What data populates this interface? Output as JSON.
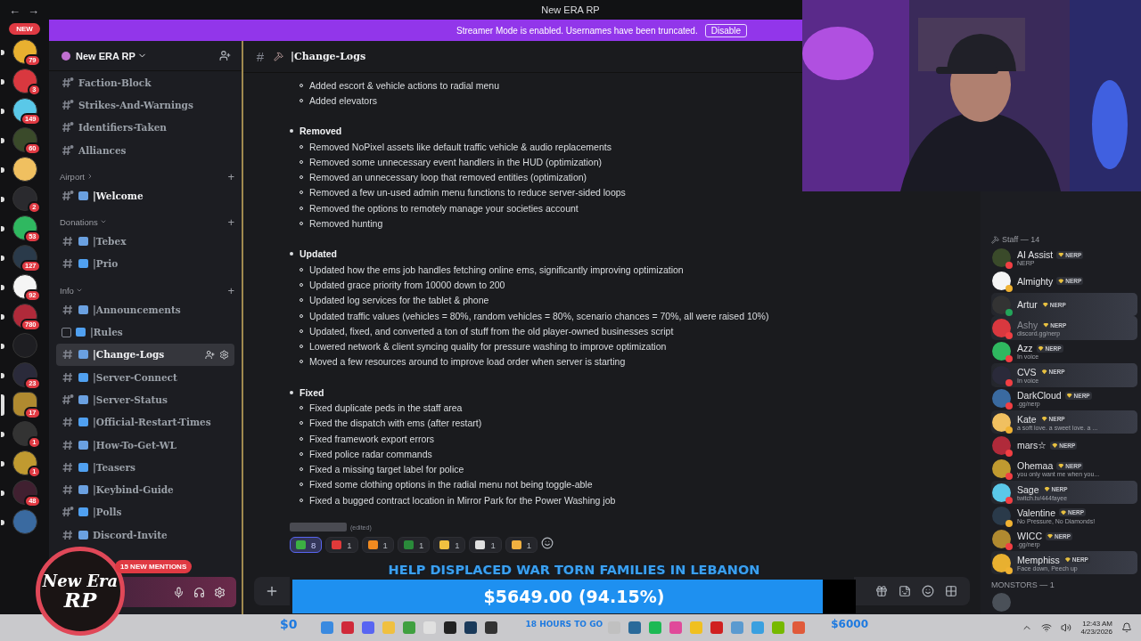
{
  "title_bar": {
    "back": "←",
    "forward": "→",
    "title": "New ERA RP"
  },
  "streamer_banner": {
    "text": "Streamer Mode is enabled. Usernames have been truncated.",
    "button": "Disable"
  },
  "server_rail": {
    "new_pill": "NEW",
    "servers": [
      {
        "badge": "79",
        "unread": true,
        "selected": false
      },
      {
        "badge": "3",
        "unread": true,
        "selected": false
      },
      {
        "badge": "149",
        "unread": true,
        "selected": false
      },
      {
        "badge": "60",
        "unread": true,
        "selected": false
      },
      {
        "unread": true,
        "selected": false
      },
      {
        "badge": "2",
        "unread": true,
        "selected": false
      },
      {
        "badge": "53",
        "unread": true,
        "selected": false
      },
      {
        "badge": "127",
        "unread": true,
        "selected": false
      },
      {
        "badge": "92",
        "unread": true,
        "selected": false
      },
      {
        "badge": "780",
        "unread": true,
        "selected": false
      },
      {
        "unread": true,
        "selected": false
      },
      {
        "badge": "23",
        "unread": true,
        "selected": false
      },
      {
        "badge": "17",
        "unread": true,
        "selected": true
      },
      {
        "badge": "1",
        "unread": true,
        "selected": false
      },
      {
        "badge": "1",
        "unread": true,
        "selected": false
      },
      {
        "badge": "48",
        "unread": true,
        "selected": false
      },
      {
        "unread": true,
        "selected": false
      }
    ]
  },
  "sidebar": {
    "server_name": "New ERA RP",
    "categories": [
      {
        "channels": [
          {
            "kind": "restricted",
            "name": "Faction-Block",
            "selected": false,
            "unread": false
          },
          {
            "kind": "restricted",
            "name": "Strikes-And-Warnings",
            "selected": false,
            "unread": false
          },
          {
            "kind": "restricted",
            "name": "Identifiers-Taken",
            "selected": false,
            "unread": false
          },
          {
            "kind": "restricted",
            "name": "Alliances",
            "selected": false,
            "unread": false
          }
        ]
      },
      {
        "name": "Airport",
        "expanded": false,
        "add": "+",
        "channels": [
          {
            "kind": "restricted",
            "emoji": true,
            "name": "|Welcome",
            "selected": false,
            "unread": true
          }
        ]
      },
      {
        "name": "Donations",
        "expanded": true,
        "add": "+",
        "channels": [
          {
            "kind": "text",
            "emoji": true,
            "name": "|Tebex",
            "selected": false,
            "unread": false
          },
          {
            "kind": "text",
            "emoji": true,
            "name": "|Prio",
            "selected": false,
            "unread": false
          }
        ]
      },
      {
        "name": "Info",
        "expanded": true,
        "add": "+",
        "channels": [
          {
            "kind": "text",
            "emoji": true,
            "name": "|Announcements",
            "selected": false,
            "unread": false
          },
          {
            "kind": "rules",
            "emoji": true,
            "name": "|Rules",
            "selected": false,
            "unread": false
          },
          {
            "kind": "text",
            "emoji": true,
            "name": "|Change-Logs",
            "selected": true,
            "unread": false
          },
          {
            "kind": "text",
            "emoji": true,
            "name": "|Server-Connect",
            "selected": false,
            "unread": false
          },
          {
            "kind": "restricted",
            "emoji": true,
            "name": "|Server-Status",
            "selected": false,
            "unread": false
          },
          {
            "kind": "text",
            "emoji": true,
            "name": "|Official-Restart-Times",
            "selected": false,
            "unread": false
          },
          {
            "kind": "text",
            "emoji": true,
            "name": "|How-To-Get-WL",
            "selected": false,
            "unread": false
          },
          {
            "kind": "text",
            "emoji": true,
            "name": "|Teasers",
            "selected": false,
            "unread": false
          },
          {
            "kind": "text",
            "emoji": true,
            "name": "|Keybind-Guide",
            "selected": false,
            "unread": false
          },
          {
            "kind": "restricted",
            "emoji": true,
            "name": "|Polls",
            "selected": false,
            "unread": false
          },
          {
            "kind": "text",
            "emoji": true,
            "name": "Discord-Invite",
            "selected": false,
            "unread": false
          }
        ]
      }
    ],
    "mentions_pill": "15 NEW MENTIONS"
  },
  "chat": {
    "hash": "#",
    "channel": "|Change-Logs",
    "sections": [
      {
        "items": [
          "Added escort & vehicle actions to radial menu",
          "Added elevators"
        ]
      },
      {
        "heading": "Removed",
        "items": [
          "Removed NoPixel assets like default traffic vehicle & audio replacements",
          "Removed some unnecessary event handlers in the HUD (optimization)",
          "Removed an unnecessary loop that removed entities (optimization)",
          "Removed a few un-used admin menu functions to reduce server-sided loops",
          "Removed the options to remotely manage your societies account",
          "Removed hunting"
        ]
      },
      {
        "heading": "Updated",
        "items": [
          "Updated how the ems job handles fetching online ems, significantly improving optimization",
          "Updated grace priority from 10000 down to 200",
          "Updated log services for the tablet & phone",
          "Updated traffic values (vehicles = 80%, random vehicles = 80%, scenario chances = 70%, all were raised 10%)",
          "Updated, fixed, and converted a ton of stuff from the old player-owned businesses script",
          "Lowered network & client syncing quality for pressure washing to improve optimization",
          "Moved a few resources around to improve load order when server is starting"
        ]
      },
      {
        "heading": "Fixed",
        "items": [
          "Fixed duplicate peds in the staff area",
          "Fixed the dispatch with ems (after restart)",
          "Fixed framework export errors",
          "Fixed police radar commands",
          "Fixed a missing target label for police",
          "Fixed some clothing options in the radial menu not being toggle-able",
          "Fixed a bugged contract location in Mirror Park for the Power Washing job"
        ]
      }
    ],
    "edited": "(edited)",
    "reactions": [
      {
        "count": "8",
        "selected": true
      },
      {
        "count": "1",
        "selected": false
      },
      {
        "count": "1",
        "selected": false
      },
      {
        "count": "1",
        "selected": false
      },
      {
        "count": "1",
        "selected": false
      },
      {
        "count": "1",
        "selected": false
      },
      {
        "count": "1",
        "selected": false
      }
    ]
  },
  "members": {
    "groups": [
      {
        "title": "Staff — 14",
        "members": [
          {
            "name": "AI Assist",
            "tag": "NERP",
            "status": "NERP",
            "color": "#f23f43",
            "banner": false,
            "dimmed": false
          },
          {
            "name": "Almighty",
            "tag": "NERP",
            "color": "#f0b232",
            "banner": false,
            "dimmed": false
          },
          {
            "name": "Artur",
            "tag": "NERP",
            "color": "#23a55a",
            "banner": true,
            "dimmed": false
          },
          {
            "name": "Ashy",
            "tag": "NERP",
            "status": "discord.gg/nerp",
            "color": "#f23f43",
            "banner": true,
            "dimmed": true
          },
          {
            "name": "Azz",
            "tag": "NERP",
            "status": "In voice",
            "color": "#f23f43",
            "banner": false,
            "dimmed": false
          },
          {
            "name": "CVS",
            "tag": "NERP",
            "status": "In voice",
            "color": "#f23f43",
            "banner": true,
            "dimmed": false
          },
          {
            "name": "DarkCloud",
            "tag": "NERP",
            "status": ".gg/nerp",
            "color": "#f23f43",
            "banner": false,
            "dimmed": false
          },
          {
            "name": "Kate",
            "tag": "NERP",
            "status": "a soft love. a sweet love. a ...",
            "color": "#f0b232",
            "banner": true,
            "dimmed": false
          },
          {
            "name": "mars☆",
            "tag": "NERP",
            "color": "#f23f43",
            "banner": false,
            "dimmed": false
          },
          {
            "name": "Ohemaa",
            "tag": "NERP",
            "status": "you only want me when you...",
            "color": "#f23f43",
            "banner": false,
            "dimmed": false
          },
          {
            "name": "Sage",
            "tag": "NERP",
            "status": "twitch.tv/444fayee",
            "color": "#f23f43",
            "banner": true,
            "dimmed": false
          },
          {
            "name": "Valentine",
            "tag": "NERP",
            "status": "No Pressure, No Diamonds!",
            "color": "#f0b232",
            "banner": false,
            "dimmed": false
          },
          {
            "name": "WICC",
            "tag": "NERP",
            "status": ".gg/nerp",
            "color": "#f23f43",
            "banner": false,
            "dimmed": false
          },
          {
            "name": "Memphiss",
            "tag": "NERP",
            "status": "Face down, Peech up",
            "color": "#f0b232",
            "banner": true,
            "dimmed": false
          }
        ]
      },
      {
        "title": "MONSTORS — 1"
      }
    ]
  },
  "donation": {
    "title": "HELP DISPLACED WAR TORN FAMILIES IN LEBANON",
    "amount": "$5649.00 (94.15%)",
    "level": 0.9415,
    "min": "$0",
    "max": "$6000",
    "time_left": "18 HOURS TO GO"
  },
  "stream_logo": {
    "line_1": "New Era",
    "line_2": "RP"
  },
  "taskbar": {
    "time": "12:43 AM",
    "date": "4/23/2026"
  }
}
